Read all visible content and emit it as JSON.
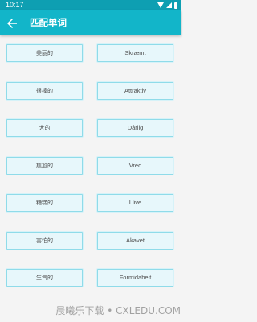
{
  "status_bar": {
    "time": "10:17"
  },
  "app_bar": {
    "title": "匹配单词"
  },
  "pairs": [
    {
      "chinese": "美丽的",
      "danish": "Skræmt"
    },
    {
      "chinese": "很棒的",
      "danish": "Attraktiv"
    },
    {
      "chinese": "大的",
      "danish": "Dårlig"
    },
    {
      "chinese": "尴尬的",
      "danish": "Vred"
    },
    {
      "chinese": "糟糕的",
      "danish": "I live"
    },
    {
      "chinese": "害怕的",
      "danish": "Akavet"
    },
    {
      "chinese": "生气的",
      "danish": "Formidabelt"
    }
  ],
  "watermark": "晨曦乐下载 • CXLEDU.COM"
}
